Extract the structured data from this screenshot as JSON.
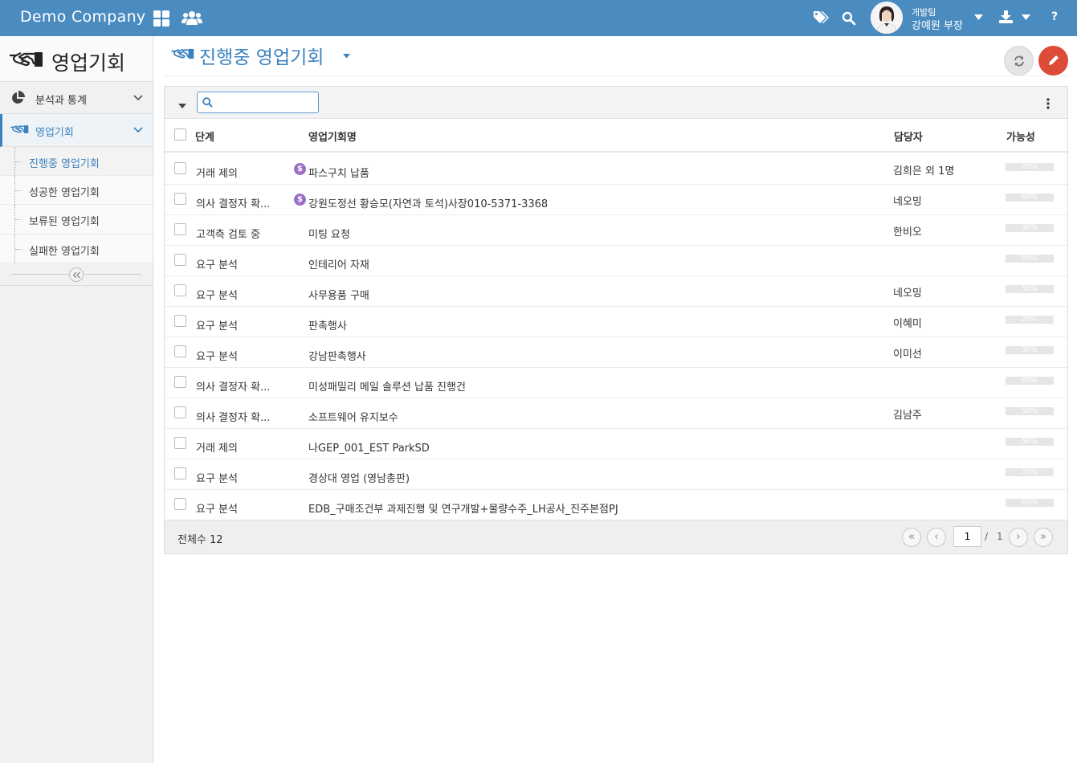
{
  "header": {
    "brand": "Demo Company",
    "icons": [
      "apps-grid-icon",
      "people-icon",
      "tags-icon",
      "search-icon",
      "download-icon",
      "help-icon"
    ],
    "user": {
      "team": "개발팀",
      "name": "강예원 부장"
    },
    "help_label": "?"
  },
  "sidebar": {
    "title": "영업기회",
    "menus": [
      {
        "label": "분석과 통계",
        "icon": "pie-chart-icon"
      },
      {
        "label": "영업기회",
        "icon": "handshake-icon",
        "active": true
      }
    ],
    "subitems": [
      {
        "label": "진행중 영업기회",
        "active": true
      },
      {
        "label": "성공한 영업기회"
      },
      {
        "label": "보류된 영업기회"
      },
      {
        "label": "실패한 영업기회"
      }
    ]
  },
  "main": {
    "title": "진행중 영업기회",
    "search_placeholder": "",
    "columns": {
      "stage": "단계",
      "name": "영업기회명",
      "owner": "담당자",
      "probability": "가능성"
    },
    "rows": [
      {
        "stage": "거래 제의",
        "name": "파스구치 납품",
        "dollar": true,
        "owner": "김희은 외 1명",
        "probability": 80,
        "probability_label": "80%"
      },
      {
        "stage": "의사 결정자 확...",
        "name": "강원도정선 황승모(자연과 토석)사장010-5371-3368",
        "dollar": true,
        "owner": "네오밍",
        "probability": 60,
        "probability_label": "60%"
      },
      {
        "stage": "고객측 검토 중",
        "name": "미팅 요청",
        "dollar": false,
        "owner": "한비오",
        "probability": 30,
        "probability_label": "30%"
      },
      {
        "stage": "요구 분석",
        "name": "인테리어 자재",
        "dollar": false,
        "owner": "",
        "probability": 50,
        "probability_label": "50%"
      },
      {
        "stage": "요구 분석",
        "name": "사무용품 구매",
        "dollar": false,
        "owner": "네오밍",
        "probability": 50,
        "probability_label": "50%"
      },
      {
        "stage": "요구 분석",
        "name": "판촉행사",
        "dollar": false,
        "owner": "이혜미",
        "probability": 20,
        "probability_label": "20%"
      },
      {
        "stage": "요구 분석",
        "name": "강남판촉행사",
        "dollar": false,
        "owner": "이미선",
        "probability": 30,
        "probability_label": "30%"
      },
      {
        "stage": "의사 결정자 확...",
        "name": "미성패밀리 메일 솔루션 납품 진행건",
        "dollar": false,
        "owner": "",
        "probability": 60,
        "probability_label": "60%"
      },
      {
        "stage": "의사 결정자 확...",
        "name": "소프트웨어 유지보수",
        "dollar": false,
        "owner": "김남주",
        "probability": 50,
        "probability_label": "50%"
      },
      {
        "stage": "거래 제의",
        "name": "나GEP_001_EST ParkSD",
        "dollar": false,
        "owner": "",
        "probability": 50,
        "probability_label": "50%"
      },
      {
        "stage": "요구 분석",
        "name": "경상대 영업 (영남총판)",
        "dollar": false,
        "owner": "",
        "probability": 30,
        "probability_label": "30%"
      },
      {
        "stage": "요구 분석",
        "name": "EDB_구매조건부 과제진행 및 연구개발+물량수주_LH공사_진주본점PJ",
        "dollar": false,
        "owner": "",
        "probability": 60,
        "probability_label": "60%"
      }
    ],
    "footer": {
      "total_label": "전체수 12",
      "current_page": "1",
      "separator": "/",
      "total_pages": "1"
    }
  },
  "colors": {
    "header_bg": "#4a8bc0",
    "accent": "#3a82bf",
    "edit_button": "#dd4b39",
    "dollar_badge": "#9b6fc7"
  }
}
